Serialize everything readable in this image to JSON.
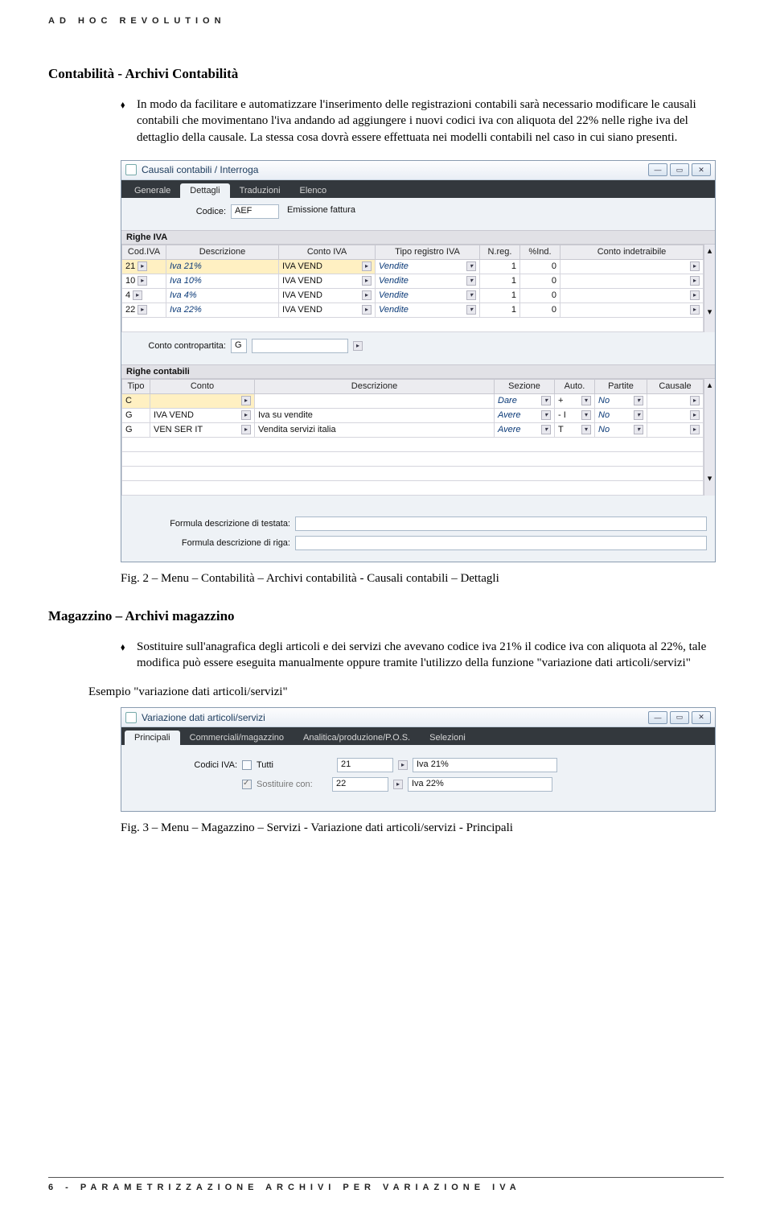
{
  "header": "AD HOC REVOLUTION",
  "footer": "6 - PARAMETRIZZAZIONE ARCHIVI PER VARIAZIONE IVA",
  "section1": {
    "title": "Contabilità - Archivi Contabilità",
    "bullet": "In modo da facilitare e automatizzare l'inserimento delle registrazioni contabili sarà necessario modificare le causali contabili che movimentano l'iva andando ad aggiungere i nuovi codici iva con aliquota del 22% nelle righe iva del dettaglio della causale. La stessa cosa dovrà essere effettuata nei modelli contabili nel caso in cui siano presenti."
  },
  "dialog1": {
    "title": "Causali contabili / Interroga",
    "tabs": [
      "Generale",
      "Dettagli",
      "Traduzioni",
      "Elenco"
    ],
    "activeTab": 1,
    "codice_label": "Codice:",
    "codice_value": "AEF",
    "codice_desc": "Emissione fattura",
    "section_iva": "Righe IVA",
    "iva_headers": [
      "Cod.IVA",
      "Descrizione",
      "Conto IVA",
      "Tipo registro IVA",
      "N.reg.",
      "%Ind.",
      "Conto indetraibile"
    ],
    "iva_rows": [
      {
        "cod": "21",
        "desc": "Iva 21%",
        "conto": "IVA VEND",
        "tipo": "Vendite",
        "nreg": "1",
        "ind": "0",
        "ci": ""
      },
      {
        "cod": "10",
        "desc": "Iva 10%",
        "conto": "IVA VEND",
        "tipo": "Vendite",
        "nreg": "1",
        "ind": "0",
        "ci": ""
      },
      {
        "cod": "4",
        "desc": "Iva 4%",
        "conto": "IVA VEND",
        "tipo": "Vendite",
        "nreg": "1",
        "ind": "0",
        "ci": ""
      },
      {
        "cod": "22",
        "desc": "Iva 22%",
        "conto": "IVA VEND",
        "tipo": "Vendite",
        "nreg": "1",
        "ind": "0",
        "ci": ""
      }
    ],
    "contropartita_label": "Conto contropartita:",
    "contropartita_value": "G",
    "section_cont": "Righe contabili",
    "cont_headers": [
      "Tipo",
      "Conto",
      "Descrizione",
      "Sezione",
      "Auto.",
      "Partite",
      "Causale"
    ],
    "cont_rows": [
      {
        "tipo": "C",
        "conto": "",
        "desc": "",
        "sez": "Dare",
        "auto": "+",
        "part": "No",
        "caus": ""
      },
      {
        "tipo": "G",
        "conto": "IVA VEND",
        "desc": "Iva su vendite",
        "sez": "Avere",
        "auto": "- I",
        "part": "No",
        "caus": ""
      },
      {
        "tipo": "G",
        "conto": "VEN SER IT",
        "desc": "Vendita servizi italia",
        "sez": "Avere",
        "auto": "T",
        "part": "No",
        "caus": ""
      }
    ],
    "formula_testata_label": "Formula descrizione di testata:",
    "formula_riga_label": "Formula descrizione di riga:"
  },
  "caption1": "Fig. 2 – Menu – Contabilità – Archivi contabilità - Causali contabili – Dettagli",
  "section2": {
    "title": "Magazzino – Archivi magazzino",
    "bullet": "Sostituire sull'anagrafica degli articoli e dei servizi che avevano codice iva 21% il codice iva con aliquota al 22%, tale modifica può essere eseguita manualmente oppure tramite l'utilizzo della funzione \"variazione dati articoli/servizi\"",
    "example": "Esempio \"variazione dati articoli/servizi\""
  },
  "dialog2": {
    "title": "Variazione dati articoli/servizi",
    "tabs": [
      "Principali",
      "Commerciali/magazzino",
      "Analitica/produzione/P.O.S.",
      "Selezioni"
    ],
    "activeTab": 0,
    "codici_iva_label": "Codici IVA:",
    "tutti_label": "Tutti",
    "codice_val": "21",
    "codice_desc": "Iva 21%",
    "sostituire_label": "Sostituire con:",
    "sost_val": "22",
    "sost_desc": "Iva 22%"
  },
  "caption2": "Fig. 3 – Menu – Magazzino – Servizi - Variazione dati articoli/servizi - Principali"
}
